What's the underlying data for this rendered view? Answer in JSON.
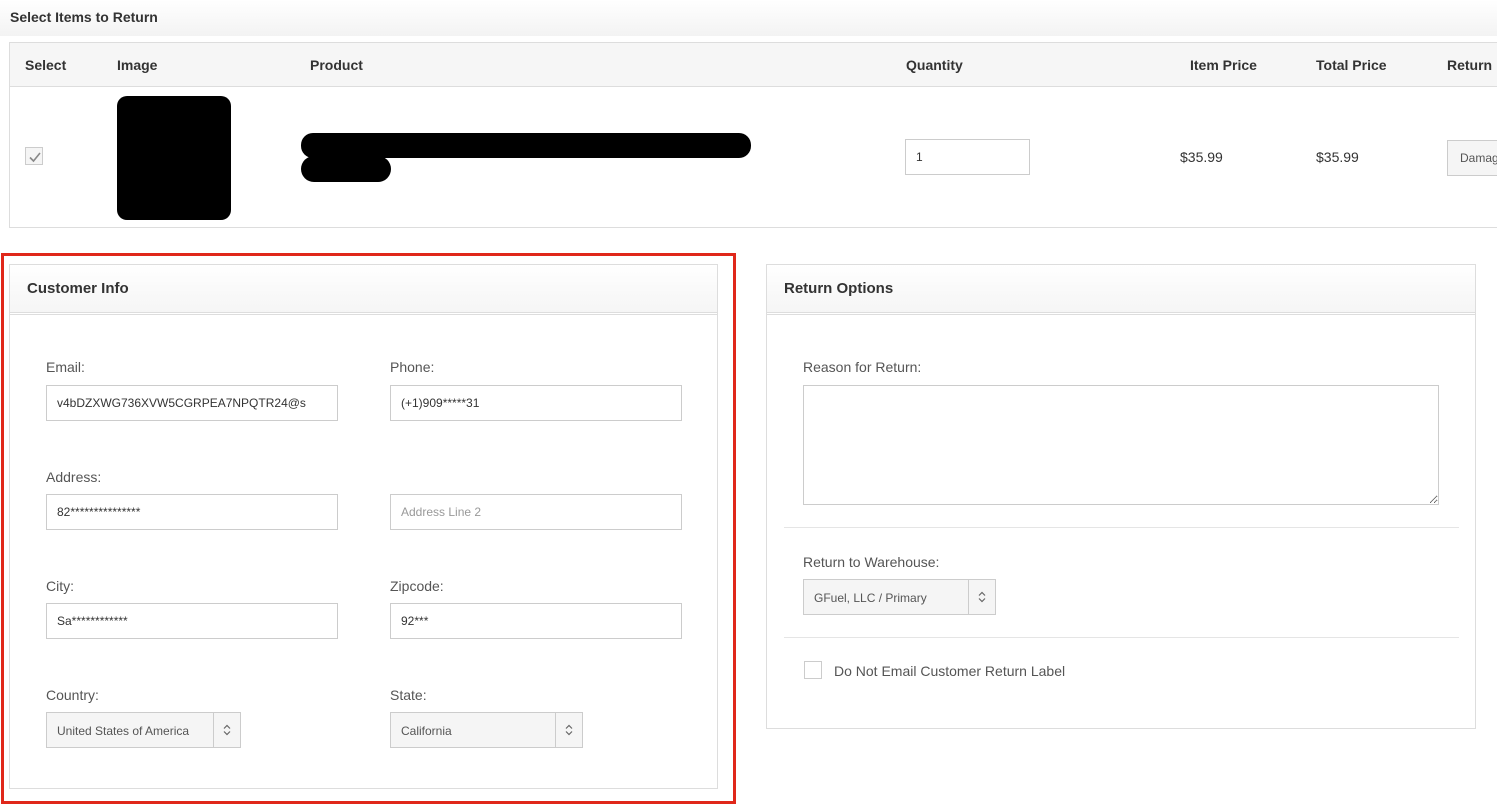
{
  "section_title": "Select Items to Return",
  "items_table": {
    "columns": [
      "Select",
      "Image",
      "Product",
      "Quantity",
      "Item Price",
      "Total Price",
      "Return"
    ],
    "rows": [
      {
        "selected": true,
        "quantity": "1",
        "item_price": "$35.99",
        "total_price": "$35.99",
        "return_reason": "Damag"
      }
    ]
  },
  "customer_info": {
    "title": "Customer Info",
    "email_label": "Email:",
    "email_value": "v4bDZXWG736XVW5CGRPEA7NPQTR24@s",
    "phone_label": "Phone:",
    "phone_value": "(+1)909*****31",
    "address_label": "Address:",
    "address_value": "82***************",
    "address2_placeholder": "Address Line 2",
    "city_label": "City:",
    "city_value": "Sa************",
    "zip_label": "Zipcode:",
    "zip_value": "92***",
    "country_label": "Country:",
    "country_value": "United States of America",
    "state_label": "State:",
    "state_value": "California"
  },
  "return_options": {
    "title": "Return Options",
    "reason_label": "Reason for Return:",
    "reason_value": "",
    "warehouse_label": "Return to Warehouse:",
    "warehouse_value": "GFuel, LLC / Primary",
    "no_email_label": "Do Not Email Customer Return Label",
    "no_email_checked": false
  },
  "colors": {
    "highlight": "#e0271a",
    "border": "#dddddd",
    "header_bg": "#f6f6f6"
  }
}
